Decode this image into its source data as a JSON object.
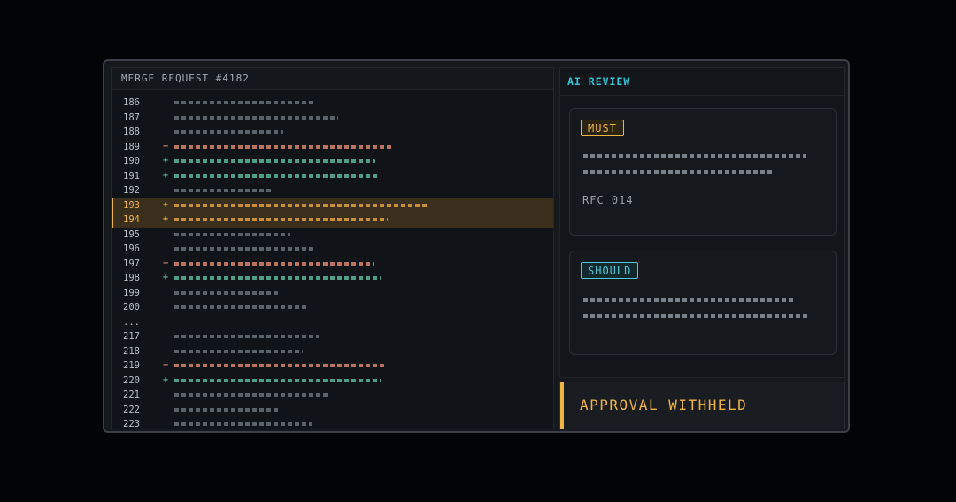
{
  "diff": {
    "title": "MERGE REQUEST #4182",
    "rows": [
      {
        "ln": "186",
        "sign": "",
        "type": "ctx"
      },
      {
        "ln": "187",
        "sign": "",
        "type": "ctx"
      },
      {
        "ln": "188",
        "sign": "",
        "type": "ctx"
      },
      {
        "ln": "189",
        "sign": "−",
        "type": "del"
      },
      {
        "ln": "190",
        "sign": "+",
        "type": "add"
      },
      {
        "ln": "191",
        "sign": "+",
        "type": "add"
      },
      {
        "ln": "192",
        "sign": "",
        "type": "ctx"
      },
      {
        "ln": "193",
        "sign": "+",
        "type": "hl"
      },
      {
        "ln": "194",
        "sign": "+",
        "type": "hl"
      },
      {
        "ln": "195",
        "sign": "",
        "type": "ctx"
      },
      {
        "ln": "196",
        "sign": "",
        "type": "ctx"
      },
      {
        "ln": "197",
        "sign": "−",
        "type": "del"
      },
      {
        "ln": "198",
        "sign": "+",
        "type": "add"
      },
      {
        "ln": "199",
        "sign": "",
        "type": "ctx"
      },
      {
        "ln": "200",
        "sign": "",
        "type": "ctx"
      },
      {
        "ln": "...",
        "sign": "",
        "type": "gap"
      },
      {
        "ln": "217",
        "sign": "",
        "type": "ctx"
      },
      {
        "ln": "218",
        "sign": "",
        "type": "ctx"
      },
      {
        "ln": "219",
        "sign": "−",
        "type": "del"
      },
      {
        "ln": "220",
        "sign": "+",
        "type": "add"
      },
      {
        "ln": "221",
        "sign": "",
        "type": "ctx"
      },
      {
        "ln": "222",
        "sign": "",
        "type": "ctx"
      },
      {
        "ln": "223",
        "sign": "",
        "type": "ctx"
      }
    ]
  },
  "review": {
    "title": "AI REVIEW",
    "must": {
      "badge": "MUST",
      "reference": "RFC 014"
    },
    "should": {
      "badge": "SHOULD"
    }
  },
  "status": {
    "label": "APPROVAL WITHHELD"
  },
  "colors": {
    "accent": "#f0b443",
    "cyan": "#38c4d6",
    "deletion": "#c98574",
    "addition": "#5fb89a"
  }
}
